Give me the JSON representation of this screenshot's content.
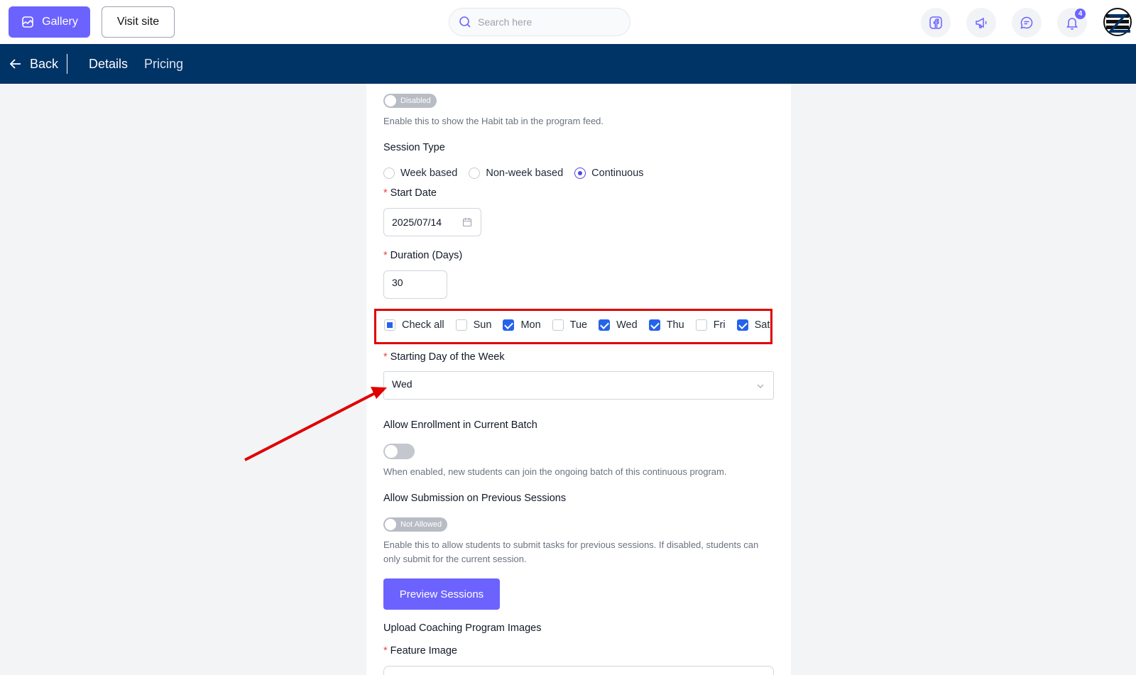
{
  "topbar": {
    "gallery_label": "Gallery",
    "visit_label": "Visit site",
    "search_placeholder": "Search here",
    "notification_count": "4"
  },
  "navbar": {
    "back_label": "Back",
    "tabs": [
      {
        "label": "Details"
      },
      {
        "label": "Pricing"
      }
    ]
  },
  "form": {
    "habit_toggle_label": "Disabled",
    "habit_help": "Enable this to show the Habit tab in the program feed.",
    "session_type_label": "Session Type",
    "session_types": [
      {
        "label": "Week based",
        "selected": false
      },
      {
        "label": "Non-week based",
        "selected": false
      },
      {
        "label": "Continuous",
        "selected": true
      }
    ],
    "required_mark": "*",
    "start_date_label": "Start Date",
    "start_date_value": "2025/07/14",
    "duration_label": "Duration (Days)",
    "duration_value": "30",
    "days": [
      {
        "label": "Check all",
        "state": "partial"
      },
      {
        "label": "Sun",
        "state": "off"
      },
      {
        "label": "Mon",
        "state": "on"
      },
      {
        "label": "Tue",
        "state": "off"
      },
      {
        "label": "Wed",
        "state": "on"
      },
      {
        "label": "Thu",
        "state": "on"
      },
      {
        "label": "Fri",
        "state": "off"
      },
      {
        "label": "Sat",
        "state": "on"
      }
    ],
    "starting_day_label": "Starting Day of the Week",
    "starting_day_value": "Wed",
    "enrollment_label": "Allow Enrollment in Current Batch",
    "enrollment_help": "When enabled, new students can join the ongoing batch of this continuous program.",
    "submission_label": "Allow Submission on Previous Sessions",
    "submission_toggle_label": "Not Allowed",
    "submission_help": "Enable this to allow students to submit tasks for previous sessions. If disabled, students can only submit for the current session.",
    "preview_label": "Preview Sessions",
    "upload_label": "Upload Coaching Program Images",
    "feature_image_label": "Feature Image"
  },
  "colors": {
    "primary": "#6c63ff",
    "navbar": "#003366",
    "annotation": "#e00000"
  }
}
